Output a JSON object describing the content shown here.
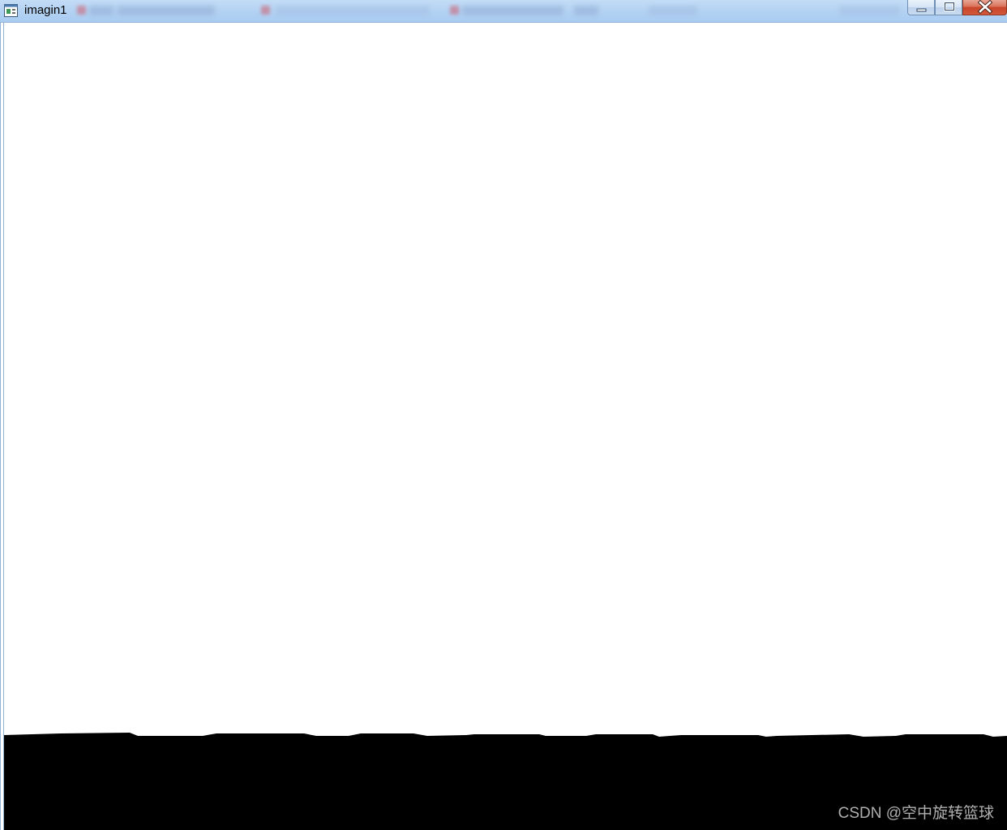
{
  "window": {
    "title": "imagin1",
    "controls": {
      "minimize_icon": "minimize-icon",
      "maximize_icon": "maximize-icon",
      "close_icon": "close-icon"
    }
  },
  "image": {
    "background_color": "#ffffff",
    "foreground_color": "#000000",
    "description_icon": "image-canvas"
  },
  "watermark": {
    "text": "CSDN @空中旋转篮球"
  },
  "colors": {
    "titlebar": "#b5d3f3",
    "close_button": "#c8452a"
  }
}
